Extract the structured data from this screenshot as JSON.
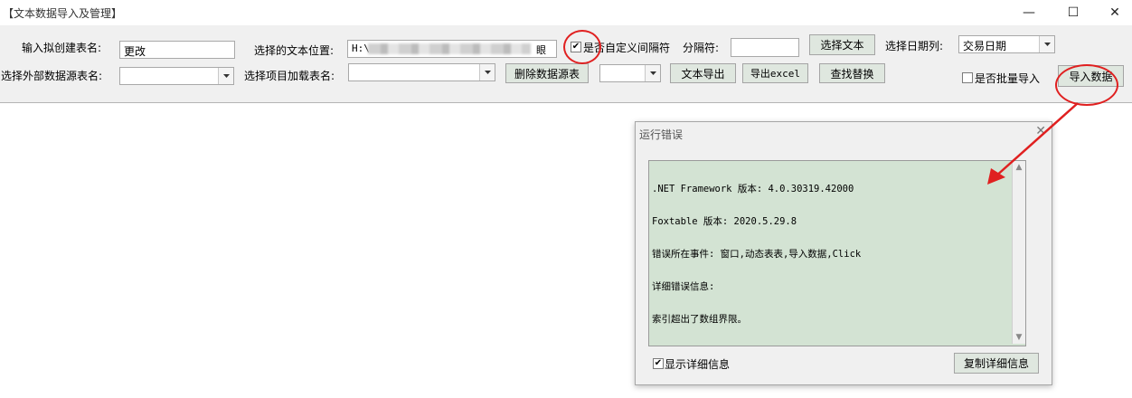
{
  "window": {
    "title": "【文本数据导入及管理】",
    "minimize_glyph": "—",
    "maximize_glyph": "☐",
    "close_glyph": "✕"
  },
  "toolbar": {
    "new_table_label": "输入拟创建表名:",
    "new_table_value": "更改",
    "text_location_label": "选择的文本位置:",
    "text_location_value_prefix": "H:\\",
    "text_location_value_suffix": "眼",
    "custom_delimiter_label": "是否自定义间隔符",
    "custom_delimiter_checked": true,
    "delimiter_label": "分隔符:",
    "delimiter_value": "",
    "choose_text_button": "选择文本",
    "date_column_label": "选择日期列:",
    "date_column_value": "交易日期",
    "external_source_label": "选择外部数据源表名:",
    "external_source_value": "",
    "project_table_label": "选择项目加载表名:",
    "project_table_value": "",
    "delete_source_button": "删除数据源表",
    "small_combo_value": "",
    "text_export_button": "文本导出",
    "excel_export_button": "导出excel",
    "find_replace_button": "查找替换",
    "batch_import_label": "是否批量导入",
    "batch_import_checked": false,
    "import_data_button": "导入数据"
  },
  "dialog": {
    "title": "运行错误",
    "close_glyph": "✕",
    "error_lines": [
      ".NET Framework 版本: 4.0.30319.42000",
      "Foxtable 版本: 2020.5.29.8",
      "错误所在事件: 窗口,动态表表,导入数据,Click",
      "详细错误信息:",
      "索引超出了数组界限。"
    ],
    "show_details_label": "显示详细信息",
    "show_details_checked": true,
    "copy_details_button": "复制详细信息"
  },
  "icons": {
    "dropdown": "chevron-down-icon",
    "check": "checkmark-icon"
  },
  "colors": {
    "button_bg": "#dfe7df",
    "error_box_bg": "#d3e3d3",
    "annotation_red": "#e02020"
  }
}
